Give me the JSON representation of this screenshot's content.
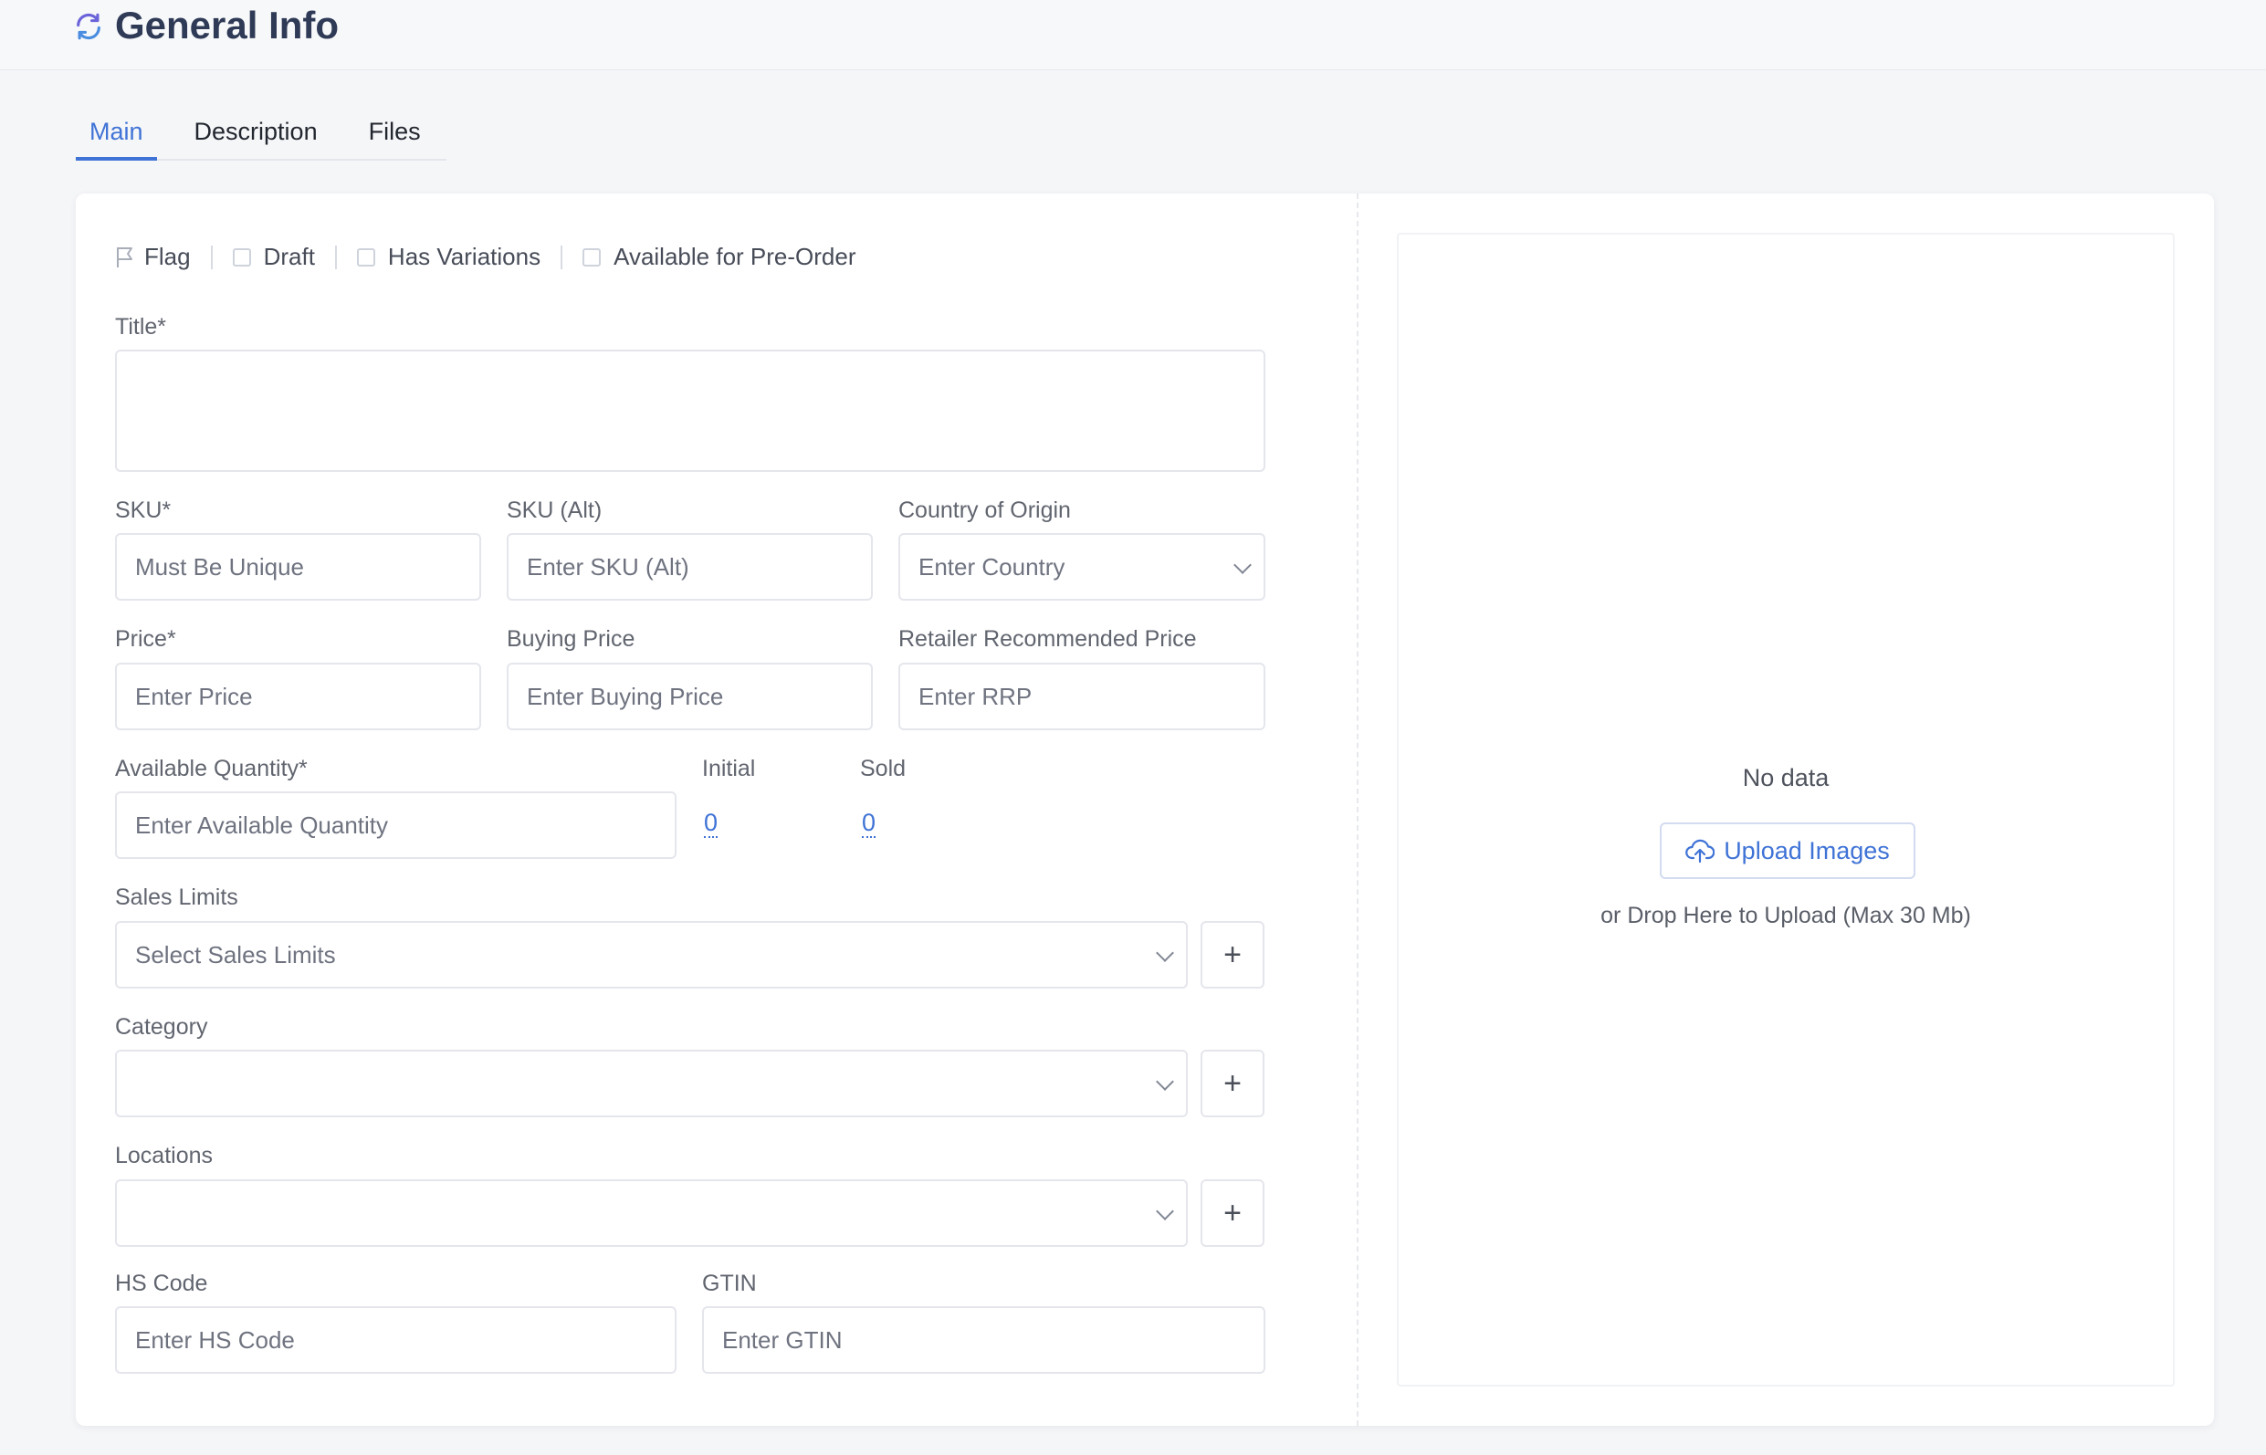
{
  "header": {
    "title": "General Info"
  },
  "tabs": [
    {
      "label": "Main"
    },
    {
      "label": "Description"
    },
    {
      "label": "Files"
    }
  ],
  "flags": {
    "flag": "Flag",
    "draft": "Draft",
    "has_variations": "Has Variations",
    "pre_order": "Available for Pre-Order"
  },
  "form": {
    "title_label": "Title*",
    "sku_label": "SKU*",
    "sku_placeholder": "Must Be Unique",
    "sku_alt_label": "SKU (Alt)",
    "sku_alt_placeholder": "Enter SKU (Alt)",
    "country_label": "Country of Origin",
    "country_placeholder": "Enter Country",
    "price_label": "Price*",
    "price_placeholder": "Enter Price",
    "buying_price_label": "Buying Price",
    "buying_price_placeholder": "Enter Buying Price",
    "rrp_label": "Retailer Recommended Price",
    "rrp_placeholder": "Enter RRP",
    "qty_label": "Available Quantity*",
    "qty_placeholder": "Enter Available Quantity",
    "initial_label": "Initial",
    "initial_value": "0",
    "sold_label": "Sold",
    "sold_value": "0",
    "sales_limits_label": "Sales Limits",
    "sales_limits_placeholder": "Select Sales Limits",
    "category_label": "Category",
    "locations_label": "Locations",
    "hs_label": "HS Code",
    "hs_placeholder": "Enter HS Code",
    "gtin_label": "GTIN",
    "gtin_placeholder": "Enter GTIN",
    "plus": "+"
  },
  "images": {
    "empty_text": "No data",
    "upload_label": "Upload Images",
    "drop_hint": "or Drop Here to Upload (Max 30 Mb)"
  },
  "colors": {
    "accent": "#3f73d6",
    "background": "#f5f6f8",
    "border": "#e4e6ec"
  }
}
